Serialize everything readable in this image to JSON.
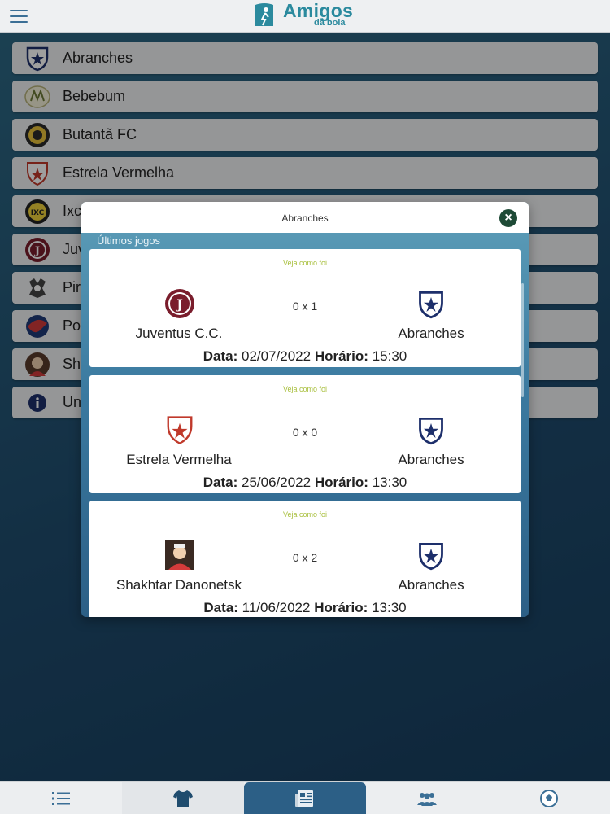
{
  "app": {
    "logo_title": "Amigos",
    "logo_subtitle": "da bola"
  },
  "teams": [
    {
      "name": "Abranches",
      "icon": "abranches-crest-icon"
    },
    {
      "name": "Bebebum",
      "icon": "bebebum-crest-icon"
    },
    {
      "name": "Butantã FC",
      "icon": "butanta-crest-icon"
    },
    {
      "name": "Estrela Vermelha",
      "icon": "estrela-vermelha-crest-icon"
    },
    {
      "name": "Ixc",
      "icon": "ixc-crest-icon"
    },
    {
      "name": "Juv",
      "icon": "juventus-crest-icon"
    },
    {
      "name": "Piri",
      "icon": "piri-crest-icon"
    },
    {
      "name": "Pov",
      "icon": "pov-crest-icon"
    },
    {
      "name": "Sha",
      "icon": "shakhtar-crest-icon"
    },
    {
      "name": "Un",
      "icon": "info-icon"
    }
  ],
  "modal": {
    "title": "Abranches",
    "close_label": "×",
    "section_label": "Últimos jogos",
    "matches": [
      {
        "link_label": "Veja como foi",
        "home": "Juventus C.C.",
        "away": "Abranches",
        "score": "0 x 1",
        "date_label": "Data:",
        "date": "02/07/2022",
        "time_label": "Horário:",
        "time": "15:30"
      },
      {
        "link_label": "Veja como foi",
        "home": "Estrela Vermelha",
        "away": "Abranches",
        "score": "0 x 0",
        "date_label": "Data:",
        "date": "25/06/2022",
        "time_label": "Horário:",
        "time": "13:30"
      },
      {
        "link_label": "Veja como foi",
        "home": "Shakhtar Danonetsk",
        "away": "Abranches",
        "score": "0 x 2",
        "date_label": "Data:",
        "date": "11/06/2022",
        "time_label": "Horário:",
        "time": "13:30"
      }
    ]
  },
  "bottom_nav": [
    {
      "icon": "list-icon"
    },
    {
      "icon": "shirt-icon"
    },
    {
      "icon": "newspaper-icon",
      "active": true
    },
    {
      "icon": "group-icon"
    },
    {
      "icon": "soccer-ball-icon"
    }
  ],
  "colors": {
    "brand": "#2b8a9e",
    "accent_dark": "#2c5f86",
    "link_green": "#a8bf3c",
    "close_button": "#1e4a36"
  }
}
